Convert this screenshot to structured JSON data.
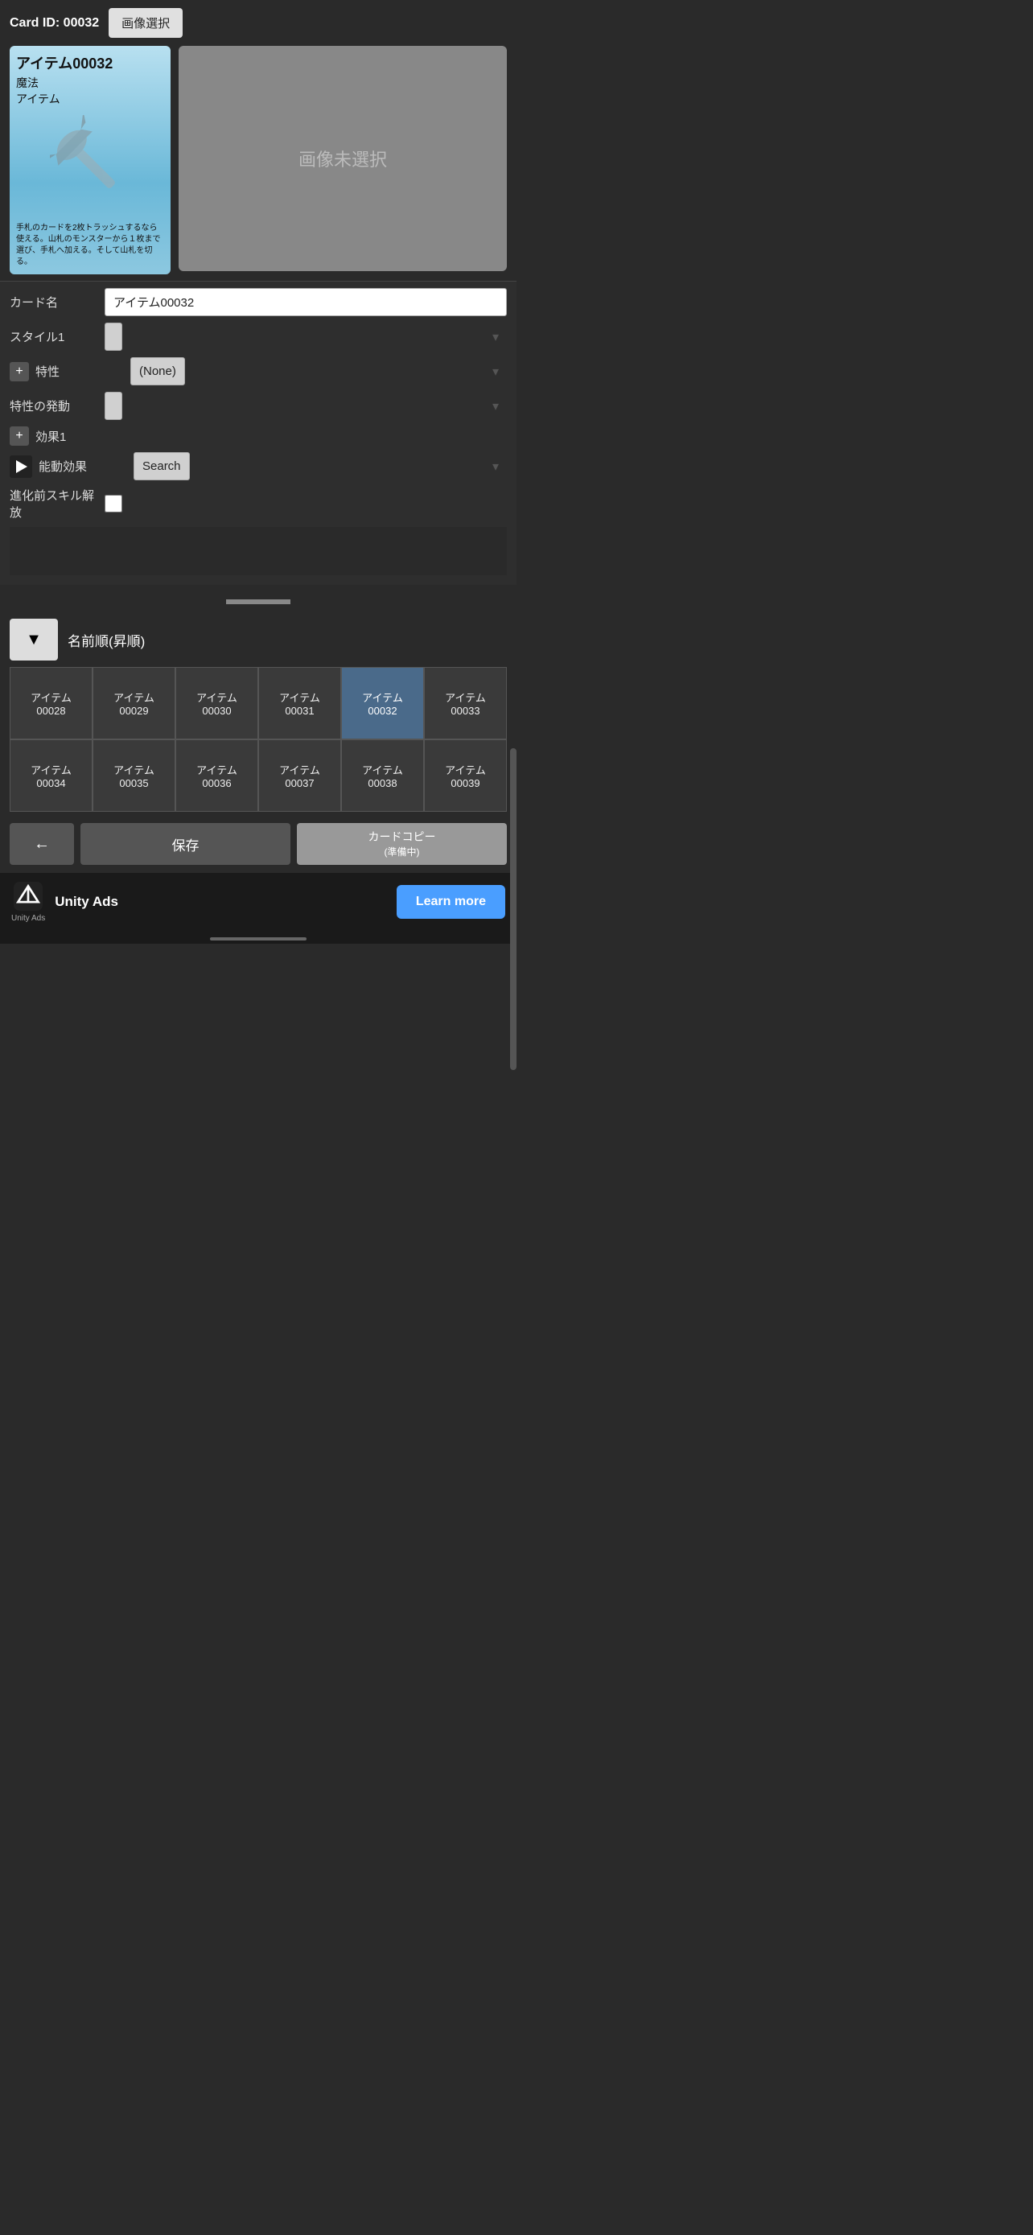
{
  "card": {
    "id_label": "Card ID: 00032",
    "image_select_btn": "画像選択",
    "title": "アイテム00032",
    "type1": "魔法",
    "type2": "アイテム",
    "description": "手札のカードを2枚トラッシュするなら使える。山札のモンスターから１枚まで選び、手札へ加える。そして山札を切る。",
    "no_image_text": "画像未選択"
  },
  "form": {
    "card_name_label": "カード名",
    "card_name_value": "アイテム00032",
    "style1_label": "スタイル1",
    "style1_value": "",
    "trait_label": "特性",
    "trait_value": "(None)",
    "trait_trigger_label": "特性の発動",
    "trait_trigger_value": "",
    "effect1_label": "効果1",
    "active_effect_label": "能動効果",
    "active_effect_placeholder": "Search",
    "evolve_label": "進化前スキル解放"
  },
  "sort": {
    "dropdown_symbol": "▼",
    "sort_label": "名前順(昇順)"
  },
  "grid": {
    "cards": [
      "アイテム\n00028",
      "アイテム\n00029",
      "アイテム\n00030",
      "アイテム\n00031",
      "アイテム\n00032",
      "アイテム\n00033",
      "アイテム\n00034",
      "アイテム\n00035",
      "アイテム\n00036",
      "アイテム\n00037",
      "アイテム\n00038",
      "アイテム\n00039"
    ]
  },
  "buttons": {
    "back": "←",
    "save": "保存",
    "copy": "カードコピー\n(準備中)"
  },
  "ad": {
    "unity_ads": "Unity Ads",
    "unity_small": "Unity  Ads",
    "learn_more": "Learn more"
  }
}
